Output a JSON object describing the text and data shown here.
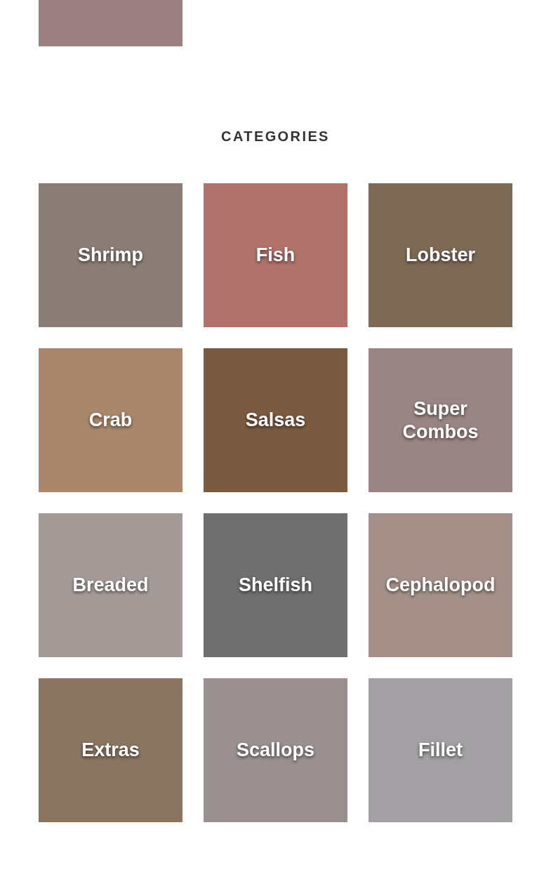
{
  "heading": "CATEGORIES",
  "categories": [
    {
      "label": "Shrimp"
    },
    {
      "label": "Fish"
    },
    {
      "label": "Lobster"
    },
    {
      "label": "Crab"
    },
    {
      "label": "Salsas"
    },
    {
      "label": "Super Combos"
    },
    {
      "label": "Breaded"
    },
    {
      "label": "Shelfish"
    },
    {
      "label": "Cephalopod"
    },
    {
      "label": "Extras"
    },
    {
      "label": "Scallops"
    },
    {
      "label": "Fillet"
    }
  ]
}
